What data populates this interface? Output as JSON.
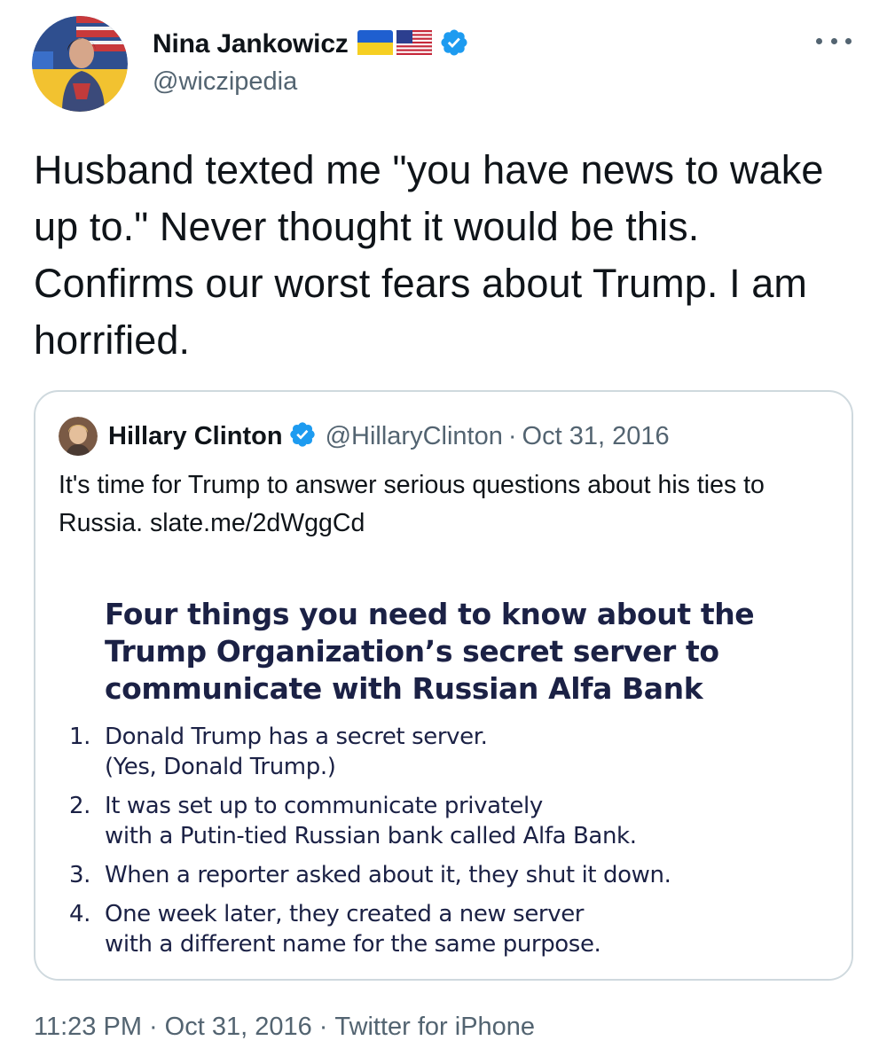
{
  "tweet": {
    "author": {
      "display_name": "Nina Jankowicz",
      "handle": "@wiczipedia",
      "flags": [
        "ukraine-flag",
        "us-flag"
      ],
      "verified_icon": "verified-badge-icon"
    },
    "more_icon": "more-options-icon",
    "text": "Husband texted me \"you have news to wake up to.\" Never thought it would be this. Confirms our worst fears about Trump. I am horrified.",
    "footer": {
      "time": "11:23 PM",
      "separator": "·",
      "date": "Oct 31, 2016",
      "source": "Twitter for iPhone"
    }
  },
  "quote": {
    "author": {
      "display_name": "Hillary Clinton",
      "handle": "@HillaryClinton",
      "separator": "·",
      "date": "Oct 31, 2016"
    },
    "text_prefix": "It's time for Trump to answer serious questions about his ties to Russia. ",
    "link": "slate.me/2dWggCd",
    "image": {
      "heading": "Four things you need to know about the Trump Organization’s secret server to communicate with Russian Alfa Bank",
      "items": [
        {
          "num": "1.",
          "line1": "Donald Trump has a secret server.",
          "line2": "(Yes, Donald Trump.)"
        },
        {
          "num": "2.",
          "line1": "It was set up to communicate privately",
          "line2": "with a Putin-tied Russian bank called Alfa Bank."
        },
        {
          "num": "3.",
          "line1": "When a reporter asked about it, they shut it down.",
          "line2": ""
        },
        {
          "num": "4.",
          "line1": "One week later, they created a new server",
          "line2": "with a different name for the same purpose."
        }
      ]
    }
  },
  "colors": {
    "text_primary": "#0f1419",
    "text_secondary": "#536471",
    "verified_blue": "#1d9bf0",
    "border": "#cfd9de",
    "image_text": "#1b2145"
  }
}
